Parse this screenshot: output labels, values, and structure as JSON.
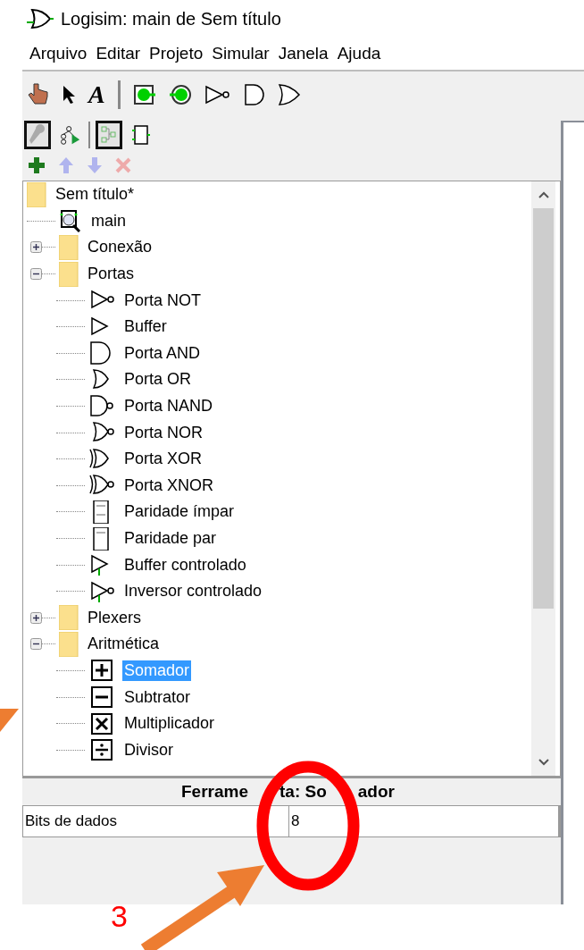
{
  "window": {
    "title": "Logisim: main de Sem título"
  },
  "menu": [
    {
      "label": "Arquivo"
    },
    {
      "label": "Editar"
    },
    {
      "label": "Projeto"
    },
    {
      "label": "Simular"
    },
    {
      "label": "Janela"
    },
    {
      "label": "Ajuda"
    }
  ],
  "toolbar": {
    "tools": [
      {
        "kind": "hand"
      },
      {
        "kind": "pointer"
      },
      {
        "kind": "text",
        "label": "A"
      },
      {
        "kind": "separator"
      },
      {
        "kind": "input-pin"
      },
      {
        "kind": "output-pin"
      },
      {
        "kind": "not"
      },
      {
        "kind": "and"
      },
      {
        "kind": "or"
      }
    ]
  },
  "explorer_toolbar": [
    {
      "kind": "wrench",
      "selected": true
    },
    {
      "kind": "simulate",
      "selected": false
    },
    {
      "kind": "separator"
    },
    {
      "kind": "layout",
      "selected": true
    },
    {
      "kind": "appearance",
      "selected": false
    }
  ],
  "project_toolbar": [
    {
      "kind": "add",
      "disabled": false
    },
    {
      "kind": "up",
      "disabled": true
    },
    {
      "kind": "down",
      "disabled": true
    },
    {
      "kind": "delete",
      "disabled": true
    }
  ],
  "tree": [
    {
      "label": "Sem título*",
      "kind": "folder",
      "children": [
        {
          "label": "main",
          "kind": "circuit",
          "selected": false
        },
        {
          "label": "Conexão",
          "kind": "folder",
          "expanded": false
        },
        {
          "label": "Portas",
          "kind": "folder",
          "expanded": true,
          "children": [
            {
              "label": "Porta NOT",
              "kind": "not",
              "selected": false
            },
            {
              "label": "Buffer",
              "kind": "buffer",
              "selected": false
            },
            {
              "label": "Porta AND",
              "kind": "and",
              "selected": false
            },
            {
              "label": "Porta OR",
              "kind": "or",
              "selected": false
            },
            {
              "label": "Porta NAND",
              "kind": "nand",
              "selected": false
            },
            {
              "label": "Porta NOR",
              "kind": "nor",
              "selected": false
            },
            {
              "label": "Porta XOR",
              "kind": "xor",
              "selected": false
            },
            {
              "label": "Porta XNOR",
              "kind": "xnor",
              "selected": false
            },
            {
              "label": "Paridade ímpar",
              "kind": "odd-parity",
              "selected": false
            },
            {
              "label": "Paridade par",
              "kind": "even-parity",
              "selected": false
            },
            {
              "label": "Buffer controlado",
              "kind": "controlled-buffer",
              "selected": false
            },
            {
              "label": "Inversor controlado",
              "kind": "controlled-inverter",
              "selected": false
            }
          ]
        },
        {
          "label": "Plexers",
          "kind": "folder",
          "expanded": false
        },
        {
          "label": "Aritmética",
          "kind": "folder",
          "expanded": true,
          "children": [
            {
              "label": "Somador",
              "kind": "adder",
              "selected": true
            },
            {
              "label": "Subtrator",
              "kind": "subtractor",
              "selected": false
            },
            {
              "label": "Multiplicador",
              "kind": "multiplier",
              "selected": false
            },
            {
              "label": "Divisor",
              "kind": "divider",
              "selected": false
            }
          ]
        }
      ]
    }
  ],
  "attributes": {
    "title_fragments": [
      "Ferrame",
      "ta: So",
      "ador"
    ],
    "rows": [
      {
        "name": "Bits de dados",
        "value": "8"
      }
    ]
  },
  "annotation": {
    "label": "3"
  }
}
